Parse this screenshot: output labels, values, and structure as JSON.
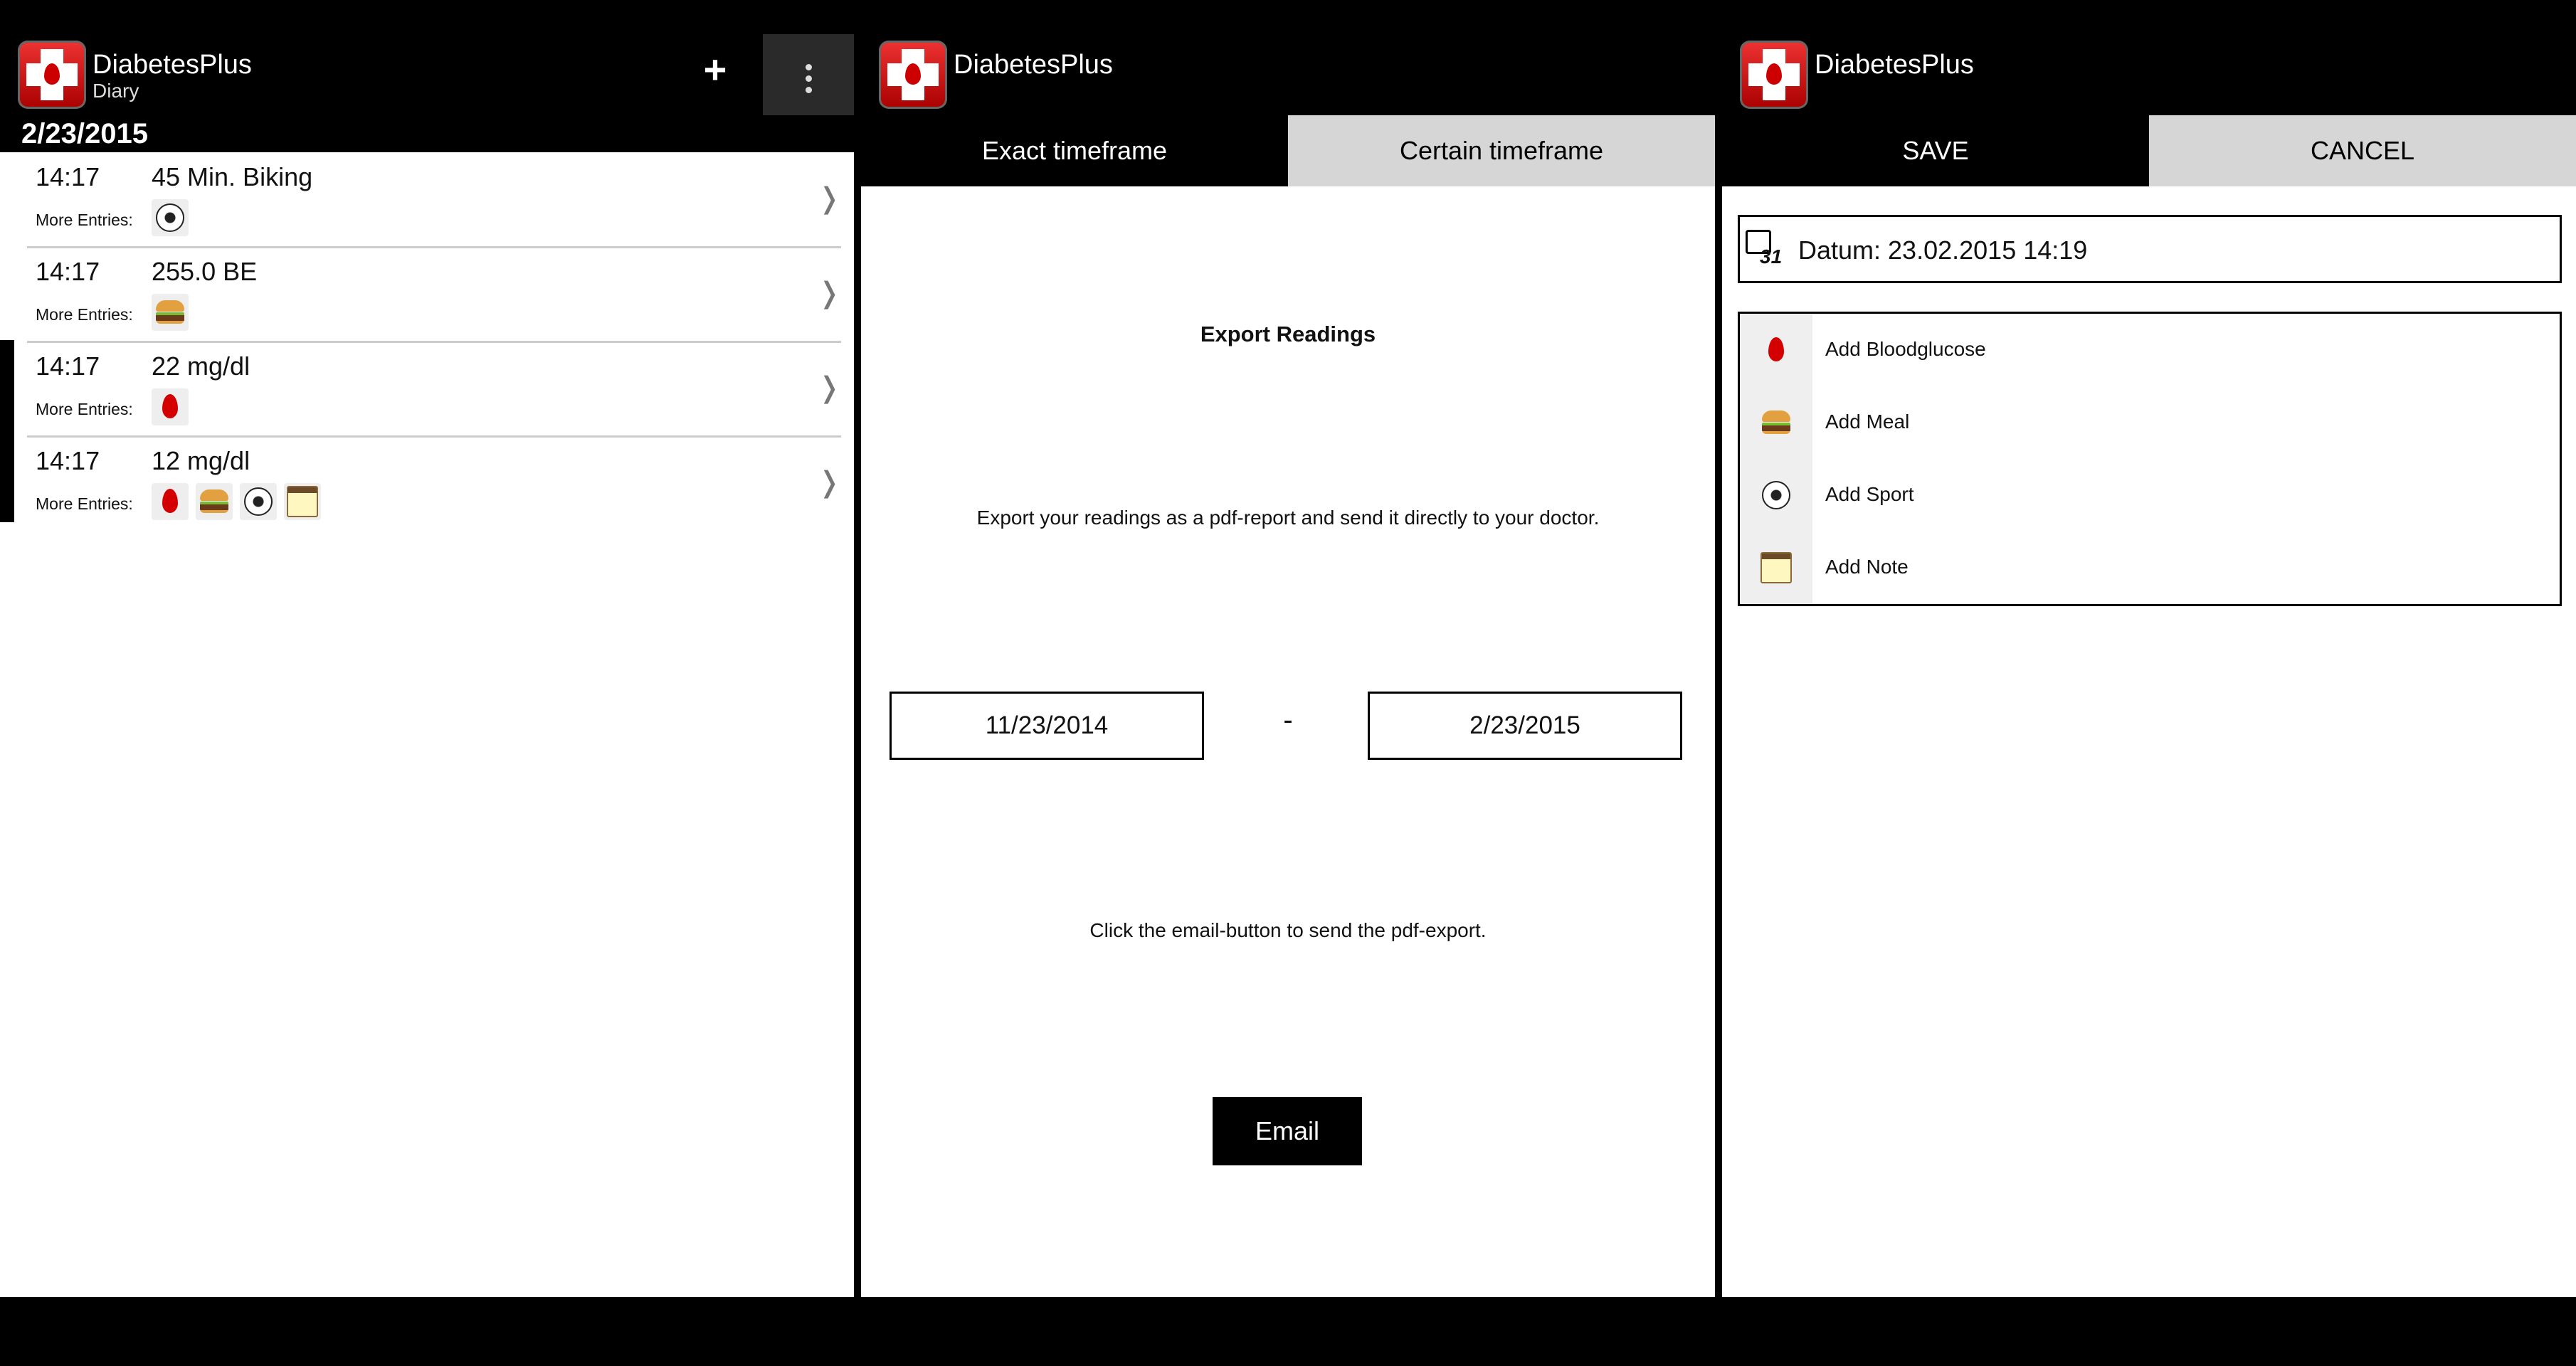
{
  "app": {
    "name": "DiabetesPlus"
  },
  "diary": {
    "subtitle": "Diary",
    "date": "2/23/2015",
    "entries": [
      {
        "time": "14:17",
        "value": "45 Min. Biking",
        "more_label": "More Entries:",
        "icons": [
          "soccer-ball-icon"
        ]
      },
      {
        "time": "14:17",
        "value": "255.0 BE",
        "more_label": "More Entries:",
        "icons": [
          "burger-icon"
        ]
      },
      {
        "time": "14:17",
        "value": "22 mg/dl",
        "more_label": "More Entries:",
        "icons": [
          "blood-drop-icon"
        ]
      },
      {
        "time": "14:17",
        "value": "12 mg/dl",
        "more_label": "More Entries:",
        "icons": [
          "blood-drop-icon",
          "burger-icon",
          "soccer-ball-icon",
          "note-icon"
        ]
      }
    ],
    "chevron": "❭"
  },
  "export": {
    "tabs": [
      "Exact timeframe",
      "Certain timeframe"
    ],
    "title": "Export Readings",
    "description": "Export your readings as a pdf-report and send it directly to your doctor.",
    "from_date": "11/23/2014",
    "separator": "-",
    "to_date": "2/23/2015",
    "email_hint": "Click the email-button to send the pdf-export.",
    "email_button": "Email"
  },
  "entry_form": {
    "save": "SAVE",
    "cancel": "CANCEL",
    "datum": "Datum: 23.02.2015 14:19",
    "calendar_number": "31",
    "actions": [
      "Add Bloodglucose",
      "Add Meal",
      "Add Sport",
      "Add Note"
    ]
  },
  "colors": {
    "brand_red": "#d40000",
    "bar": "#000000",
    "tab_inactive": "#d6d6d6"
  }
}
